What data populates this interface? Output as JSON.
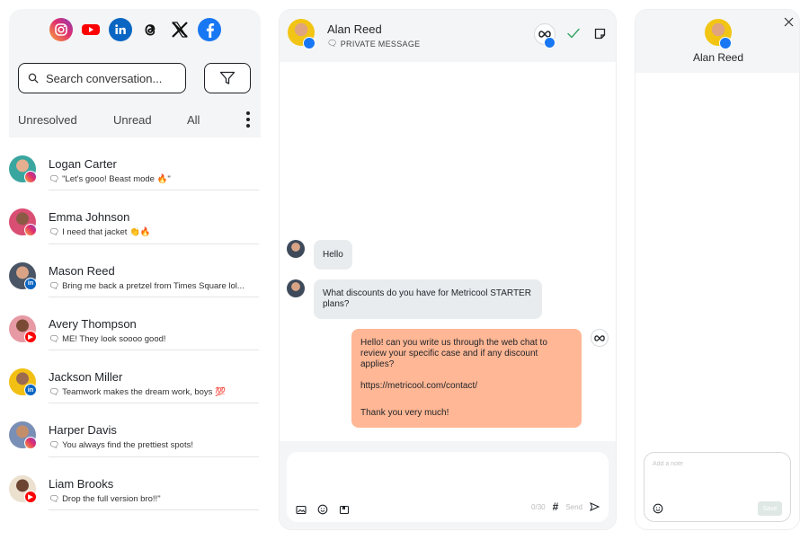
{
  "socials": [
    "instagram-icon",
    "youtube-icon",
    "linkedin-icon",
    "threads-icon",
    "x-icon",
    "facebook-icon"
  ],
  "search": {
    "placeholder": "Search conversation..."
  },
  "tabs": [
    "Unresolved",
    "Unread",
    "All"
  ],
  "conversations": [
    {
      "name": "Logan Carter",
      "preview": "\"Let's gooo! Beast mode 🔥\"",
      "network": "instagram",
      "avatar_color": "#3aa6a0"
    },
    {
      "name": "Emma Johnson",
      "preview": "I need that jacket 👏🔥",
      "network": "instagram",
      "avatar_color": "#d94e73"
    },
    {
      "name": "Mason Reed",
      "preview": "Bring me back a pretzel from Times Square lol...",
      "network": "linkedin",
      "avatar_color": "#4a5566"
    },
    {
      "name": "Avery Thompson",
      "preview": "ME! They look soooo good!",
      "network": "youtube",
      "avatar_color": "#e79aa4"
    },
    {
      "name": "Jackson Miller",
      "preview": "Teamwork makes the dream work, boys 💯",
      "network": "linkedin",
      "avatar_color": "#f2c014"
    },
    {
      "name": "Harper Davis",
      "preview": "You always find the prettiest spots!",
      "network": "instagram",
      "avatar_color": "#7a8fb5"
    },
    {
      "name": "Liam Brooks",
      "preview": "Drop the full version bro!!\"",
      "network": "youtube",
      "avatar_color": "#ece0cf"
    }
  ],
  "chat": {
    "contact_name": "Alan Reed",
    "channel": "PRIVATE MESSAGE",
    "messages": [
      {
        "direction": "in",
        "text": "Hello"
      },
      {
        "direction": "in",
        "text": "What discounts do you have for Metricool STARTER plans?"
      },
      {
        "direction": "out",
        "paragraphs": [
          "Hello! can you write us through the web chat to review your specific case and if any discount applies?",
          "https://metricool.com/contact/",
          "Thank you very much!"
        ]
      }
    ],
    "counter": "0/30",
    "send_label": "Send"
  },
  "contact_panel": {
    "name": "Alan Reed",
    "note_placeholder": "Add a note",
    "save_label": "Save"
  },
  "colors": {
    "accent_out": "#ffb795",
    "facebook": "#1877f2",
    "instagram": "#e1306c",
    "youtube": "#ff0000",
    "linkedin": "#0a66c2"
  }
}
